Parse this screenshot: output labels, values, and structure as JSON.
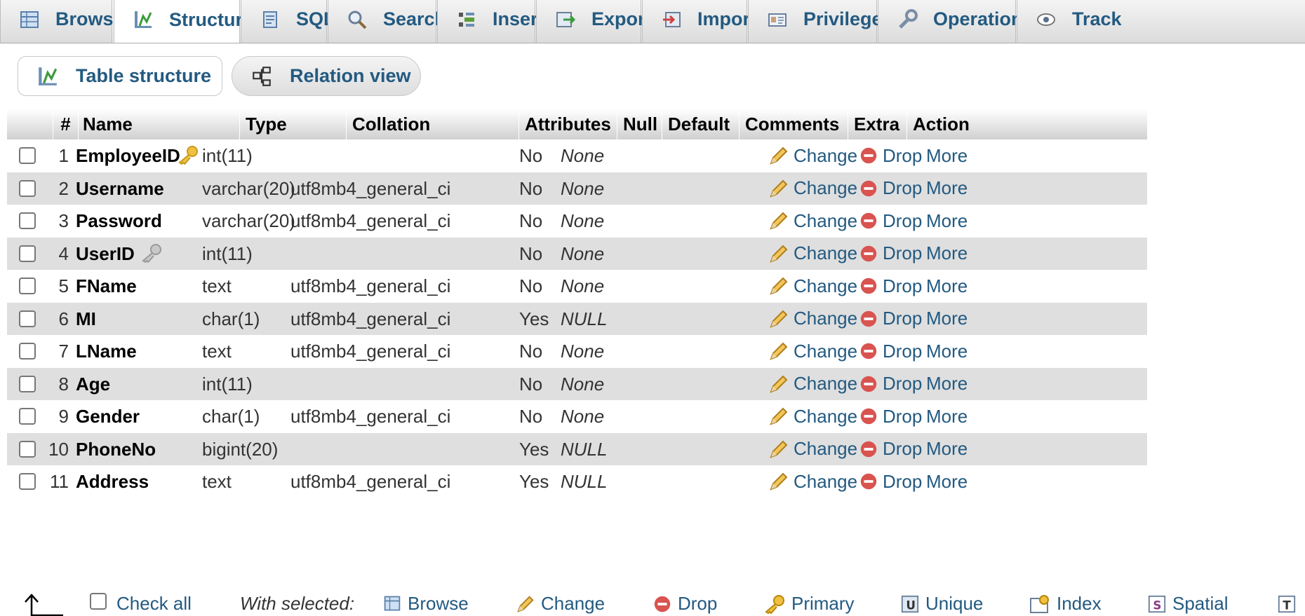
{
  "tabs": [
    {
      "label": "Browse",
      "icon": "browse-icon"
    },
    {
      "label": "Structure",
      "icon": "structure-icon",
      "active": true
    },
    {
      "label": "SQL",
      "icon": "sql-icon"
    },
    {
      "label": "Search",
      "icon": "search-icon"
    },
    {
      "label": "Insert",
      "icon": "insert-icon"
    },
    {
      "label": "Export",
      "icon": "export-icon"
    },
    {
      "label": "Import",
      "icon": "import-icon"
    },
    {
      "label": "Privileges",
      "icon": "privileges-icon"
    },
    {
      "label": "Operations",
      "icon": "operations-icon"
    },
    {
      "label": "Track",
      "icon": "tracking-icon"
    }
  ],
  "subtabs": [
    {
      "label": "Table structure",
      "icon": "structure-icon"
    },
    {
      "label": "Relation view",
      "icon": "relation-icon"
    }
  ],
  "table": {
    "headers": {
      "num": "#",
      "name": "Name",
      "type": "Type",
      "collation": "Collation",
      "attributes": "Attributes",
      "null": "Null",
      "default": "Default",
      "comments": "Comments",
      "extra": "Extra",
      "action": "Action"
    },
    "actions": {
      "change": "Change",
      "drop": "Drop",
      "more": "More"
    },
    "rows": [
      {
        "num": "1",
        "name": "EmployeeID",
        "type": "int(11)",
        "collation": "",
        "null": "No",
        "default": "None",
        "key": "primary-key-icon"
      },
      {
        "num": "2",
        "name": "Username",
        "type": "varchar(20)",
        "collation": "utf8mb4_general_ci",
        "null": "No",
        "default": "None"
      },
      {
        "num": "3",
        "name": "Password",
        "type": "varchar(20)",
        "collation": "utf8mb4_general_ci",
        "null": "No",
        "default": "None"
      },
      {
        "num": "4",
        "name": "UserID",
        "type": "int(11)",
        "collation": "",
        "null": "No",
        "default": "None",
        "key": "index-key-icon"
      },
      {
        "num": "5",
        "name": "FName",
        "type": "text",
        "collation": "utf8mb4_general_ci",
        "null": "No",
        "default": "None"
      },
      {
        "num": "6",
        "name": "MI",
        "type": "char(1)",
        "collation": "utf8mb4_general_ci",
        "null": "Yes",
        "default": "NULL"
      },
      {
        "num": "7",
        "name": "LName",
        "type": "text",
        "collation": "utf8mb4_general_ci",
        "null": "No",
        "default": "None"
      },
      {
        "num": "8",
        "name": "Age",
        "type": "int(11)",
        "collation": "",
        "null": "No",
        "default": "None"
      },
      {
        "num": "9",
        "name": "Gender",
        "type": "char(1)",
        "collation": "utf8mb4_general_ci",
        "null": "No",
        "default": "None"
      },
      {
        "num": "10",
        "name": "PhoneNo",
        "type": "bigint(20)",
        "collation": "",
        "null": "Yes",
        "default": "NULL"
      },
      {
        "num": "11",
        "name": "Address",
        "type": "text",
        "collation": "utf8mb4_general_ci",
        "null": "Yes",
        "default": "NULL"
      }
    ]
  },
  "footer": {
    "check_all": "Check all",
    "with_selected": "With selected:",
    "actions": [
      {
        "label": "Browse",
        "icon": "browse-icon"
      },
      {
        "label": "Change",
        "icon": "pencil-icon"
      },
      {
        "label": "Drop",
        "icon": "drop-icon"
      },
      {
        "label": "Primary",
        "icon": "primary-key-icon"
      },
      {
        "label": "Unique",
        "icon": "unique-icon"
      },
      {
        "label": "Index",
        "icon": "index-icon"
      },
      {
        "label": "Spatial",
        "icon": "spatial-icon"
      },
      {
        "label": "",
        "icon": "fulltext-icon"
      }
    ]
  },
  "colors": {
    "link": "#235a81",
    "row_alt": "#dfdfdf",
    "drop_red": "#d9534f",
    "pencil": "#e6a817"
  }
}
